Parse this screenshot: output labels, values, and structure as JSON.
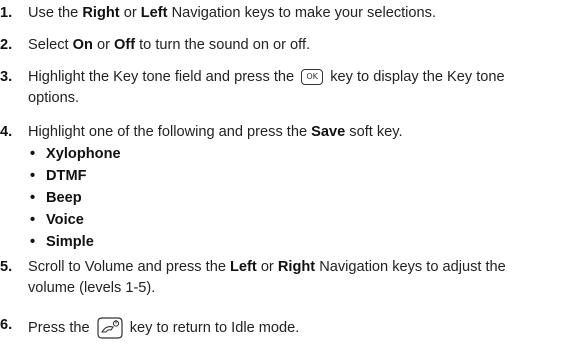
{
  "steps": [
    {
      "number": "1.",
      "lines": [
        [
          {
            "t": "Use the "
          },
          {
            "t": "Right",
            "b": true
          },
          {
            "t": " or "
          },
          {
            "t": "Left",
            "b": true
          },
          {
            "t": " Navigation keys to make your selections."
          }
        ]
      ]
    },
    {
      "number": "2.",
      "lines": [
        [
          {
            "t": "Select "
          },
          {
            "t": "On",
            "b": true
          },
          {
            "t": " or "
          },
          {
            "t": "Off",
            "b": true
          },
          {
            "t": " to turn the sound on or off."
          }
        ]
      ]
    },
    {
      "number": "3.",
      "lines": [
        [
          {
            "t": "Highlight the Key tone field and press the "
          },
          {
            "icon": "ok-key-icon",
            "label": "OK"
          },
          {
            "t": " key to display the Key tone"
          }
        ],
        [
          {
            "t": "options."
          }
        ]
      ]
    },
    {
      "number": "4.",
      "lines": [
        [
          {
            "t": "Highlight one of the following and press the "
          },
          {
            "t": "Save",
            "b": true
          },
          {
            "t": " soft key."
          }
        ]
      ],
      "bullets": [
        "Xylophone",
        "DTMF",
        "Beep",
        "Voice",
        "Simple"
      ]
    },
    {
      "number": "5.",
      "lines": [
        [
          {
            "t": "Scroll to Volume and press the "
          },
          {
            "t": "Left",
            "b": true
          },
          {
            "t": " or "
          },
          {
            "t": "Right",
            "b": true
          },
          {
            "t": " Navigation keys to adjust the"
          }
        ],
        [
          {
            "t": "volume (levels 1-5)."
          }
        ]
      ]
    },
    {
      "number": "6.",
      "lines": [
        [
          {
            "t": "Press the "
          },
          {
            "icon": "end-key-icon"
          },
          {
            "t": " key to return to Idle mode."
          }
        ]
      ]
    }
  ],
  "bullet_glyph": "•"
}
